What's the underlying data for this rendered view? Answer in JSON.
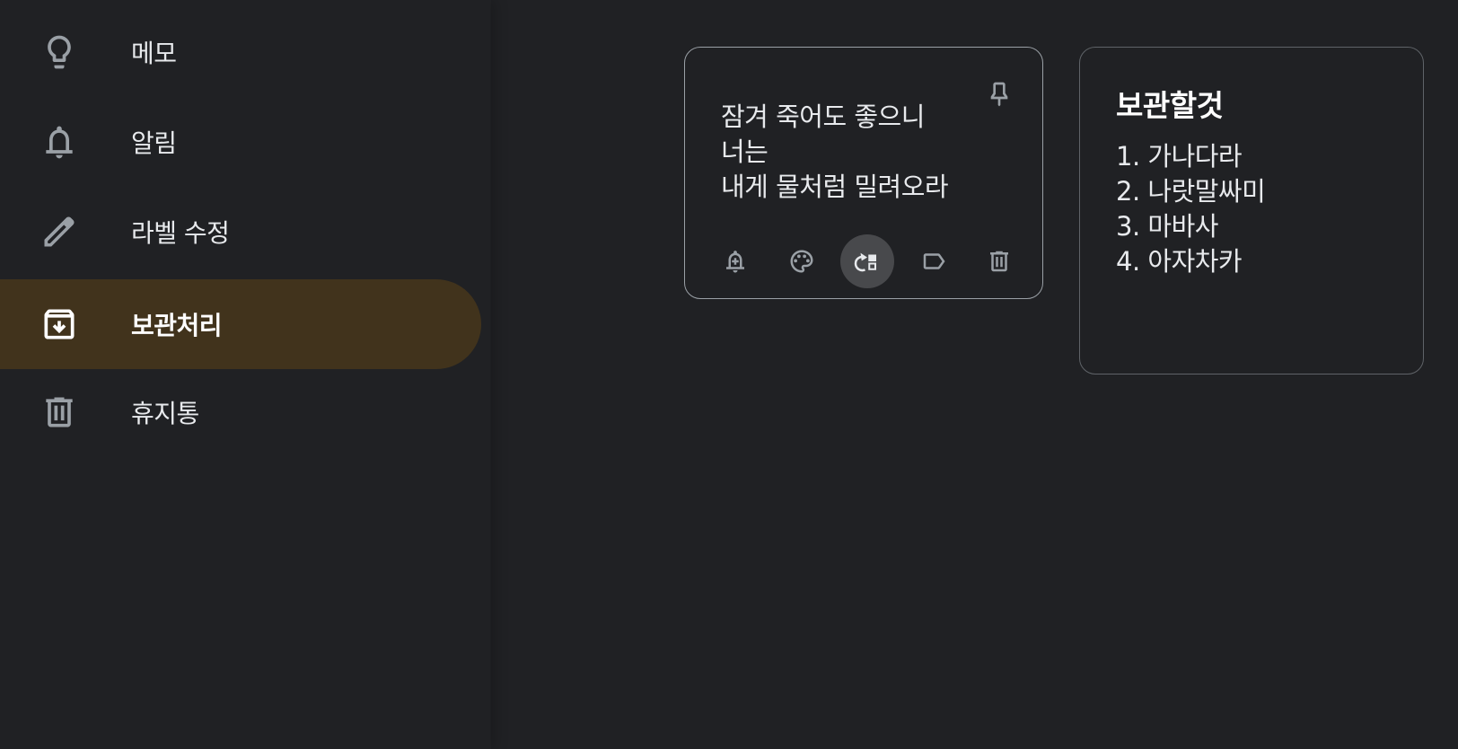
{
  "sidebar": {
    "items": [
      {
        "label": "메모",
        "icon": "lightbulb-icon"
      },
      {
        "label": "알림",
        "icon": "bell-icon"
      },
      {
        "label": "라벨 수정",
        "icon": "pencil-icon"
      },
      {
        "label": "보관처리",
        "icon": "archive-icon",
        "active": true
      },
      {
        "label": "휴지통",
        "icon": "trash-icon"
      }
    ]
  },
  "notes": [
    {
      "title": "",
      "text": "잠겨 죽어도 좋으니\n너는\n내게 물처럼 밀려오라",
      "toolbar": [
        "bell-plus-icon",
        "palette-icon",
        "unarchive-icon",
        "label-icon",
        "trash-icon"
      ]
    },
    {
      "title": "보관할것",
      "text": "1. 가나다라\n2. 나랏말싸미\n3. 마바사\n4. 아자차카"
    }
  ],
  "colors": {
    "background": "#202124",
    "active_nav": "#41331c",
    "note_border": "#5f6368",
    "text": "#e8eaed",
    "icon": "#9aa0a6"
  }
}
